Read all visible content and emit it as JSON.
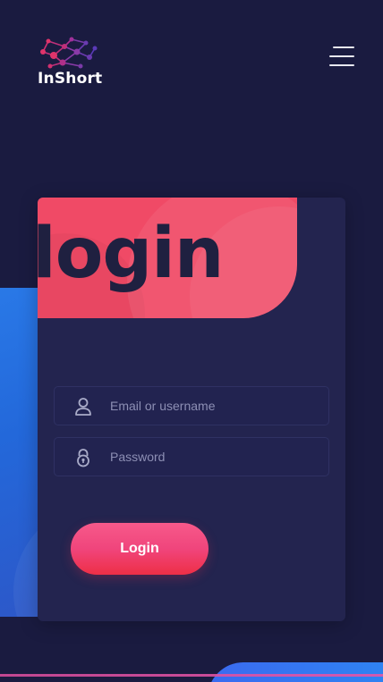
{
  "header": {
    "brand": "InShort",
    "logo_icon": "network-nodes-icon",
    "menu_icon": "hamburger-menu-icon"
  },
  "login_card": {
    "title": "login",
    "email_field": {
      "icon": "user-icon",
      "placeholder": "Email or username",
      "value": ""
    },
    "password_field": {
      "icon": "lock-icon",
      "placeholder": "Password",
      "value": ""
    },
    "submit_label": "Login"
  },
  "colors": {
    "background": "#1a1b40",
    "card": "#23244f",
    "accent_pink": "#f04a66",
    "accent_blue": "#2a7ae8",
    "button_gradient": [
      "#f7598a",
      "#ee2f46"
    ]
  }
}
